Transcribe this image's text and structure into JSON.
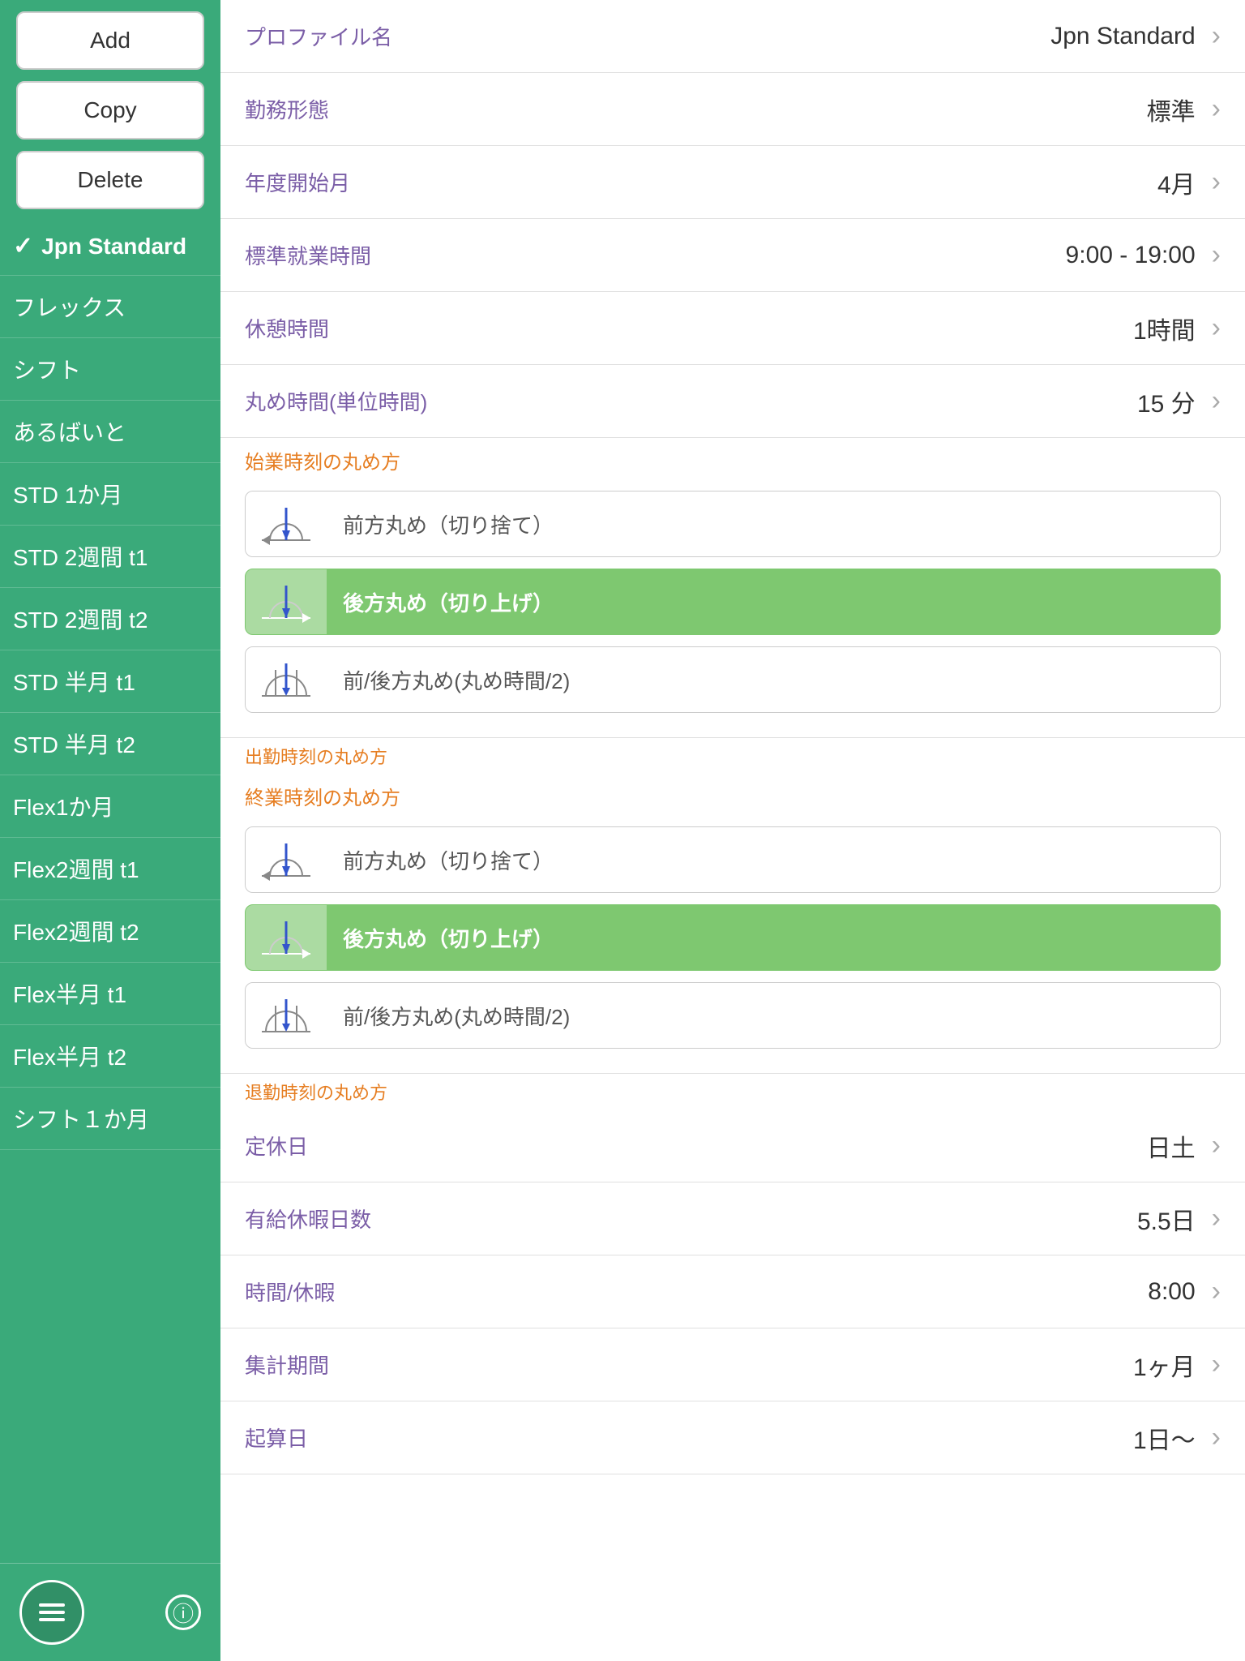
{
  "sidebar": {
    "add_label": "Add",
    "copy_label": "Copy",
    "delete_label": "Delete",
    "items": [
      {
        "id": "jpn-standard",
        "label": "Jpn Standard",
        "active": true,
        "check": true
      },
      {
        "id": "flex",
        "label": "フレックス",
        "active": false,
        "check": false
      },
      {
        "id": "shift",
        "label": "シフト",
        "active": false,
        "check": false
      },
      {
        "id": "arubaito",
        "label": "あるばいと",
        "active": false,
        "check": false
      },
      {
        "id": "std1month",
        "label": "STD 1か月",
        "active": false,
        "check": false
      },
      {
        "id": "std2week-t1",
        "label": "STD 2週間 t1",
        "active": false,
        "check": false
      },
      {
        "id": "std2week-t2",
        "label": "STD 2週間 t2",
        "active": false,
        "check": false
      },
      {
        "id": "std-halfmonth-t1",
        "label": "STD 半月 t1",
        "active": false,
        "check": false
      },
      {
        "id": "std-halfmonth-t2",
        "label": "STD 半月 t2",
        "active": false,
        "check": false
      },
      {
        "id": "flex1month",
        "label": "Flex1か月",
        "active": false,
        "check": false
      },
      {
        "id": "flex2week-t1",
        "label": "Flex2週間 t1",
        "active": false,
        "check": false
      },
      {
        "id": "flex2week-t2",
        "label": "Flex2週間 t2",
        "active": false,
        "check": false
      },
      {
        "id": "flex-halfmonth-t1",
        "label": "Flex半月 t1",
        "active": false,
        "check": false
      },
      {
        "id": "flex-halfmonth-t2",
        "label": "Flex半月 t2",
        "active": false,
        "check": false
      },
      {
        "id": "shift1month",
        "label": "シフト１か月",
        "active": false,
        "check": false
      }
    ]
  },
  "content": {
    "profile_name_label": "プロファイル名",
    "profile_name_value": "Jpn Standard",
    "work_type_label": "勤務形態",
    "work_type_value": "標準",
    "fiscal_start_label": "年度開始月",
    "fiscal_start_value": "4月",
    "work_hours_label": "標準就業時間",
    "work_hours_value": "9:00 - 19:00",
    "break_time_label": "休憩時間",
    "break_time_value": "1時間",
    "rounding_unit_label": "丸め時間(単位時間)",
    "rounding_unit_value": "15 分",
    "start_rounding_section": "始業時刻の丸め方",
    "start_rounding_options": [
      {
        "id": "forward",
        "label": "前方丸め（切り捨て）",
        "selected": false,
        "icon_type": "forward"
      },
      {
        "id": "backward",
        "label": "後方丸め（切り上げ）",
        "selected": true,
        "icon_type": "backward"
      },
      {
        "id": "both",
        "label": "前/後方丸め(丸め時間/2)",
        "selected": false,
        "icon_type": "both"
      }
    ],
    "depart_rounding_label": "出勤時刻の丸め方",
    "end_rounding_section": "終業時刻の丸め方",
    "end_rounding_options": [
      {
        "id": "forward2",
        "label": "前方丸め（切り捨て）",
        "selected": false,
        "icon_type": "forward"
      },
      {
        "id": "backward2",
        "label": "後方丸め（切り上げ）",
        "selected": true,
        "icon_type": "backward"
      },
      {
        "id": "both2",
        "label": "前/後方丸め(丸め時間/2)",
        "selected": false,
        "icon_type": "both"
      }
    ],
    "leave_rounding_label": "退勤時刻の丸め方",
    "fixed_holiday_label": "定休日",
    "fixed_holiday_value": "日土",
    "paid_leave_label": "有給休暇日数",
    "paid_leave_value": "5.5日",
    "hourly_leave_label": "時間/休暇",
    "hourly_leave_value": "8:00",
    "aggregate_period_label": "集計期間",
    "aggregate_period_value": "1ヶ月",
    "start_date_label": "起算日",
    "start_date_value": "1日〜"
  },
  "icons": {
    "menu": "menu-icon",
    "info": "info-icon",
    "chevron_right": "›"
  }
}
